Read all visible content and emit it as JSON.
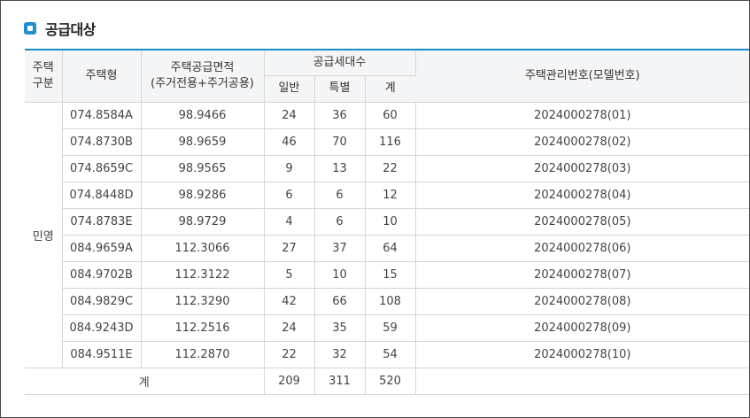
{
  "section_title": "공급대상",
  "headers": {
    "category": [
      "주택",
      "구분"
    ],
    "type": "주택형",
    "area": [
      "주택공급면적",
      "(주거전용+주거공용)"
    ],
    "households": "공급세대수",
    "general": "일반",
    "special": "특별",
    "sum": "계",
    "model_no": "주택관리번호(모델번호)"
  },
  "category_value": "민영",
  "rows": [
    {
      "type": "074.8584A",
      "area": "98.9466",
      "general": "24",
      "special": "36",
      "sum": "60",
      "model": "2024000278(01)"
    },
    {
      "type": "074.8730B",
      "area": "98.9659",
      "general": "46",
      "special": "70",
      "sum": "116",
      "model": "2024000278(02)"
    },
    {
      "type": "074.8659C",
      "area": "98.9565",
      "general": "9",
      "special": "13",
      "sum": "22",
      "model": "2024000278(03)"
    },
    {
      "type": "074.8448D",
      "area": "98.9286",
      "general": "6",
      "special": "6",
      "sum": "12",
      "model": "2024000278(04)"
    },
    {
      "type": "074.8783E",
      "area": "98.9729",
      "general": "4",
      "special": "6",
      "sum": "10",
      "model": "2024000278(05)"
    },
    {
      "type": "084.9659A",
      "area": "112.3066",
      "general": "27",
      "special": "37",
      "sum": "64",
      "model": "2024000278(06)"
    },
    {
      "type": "084.9702B",
      "area": "112.3122",
      "general": "5",
      "special": "10",
      "sum": "15",
      "model": "2024000278(07)"
    },
    {
      "type": "084.9829C",
      "area": "112.3290",
      "general": "42",
      "special": "66",
      "sum": "108",
      "model": "2024000278(08)"
    },
    {
      "type": "084.9243D",
      "area": "112.2516",
      "general": "24",
      "special": "35",
      "sum": "59",
      "model": "2024000278(09)"
    },
    {
      "type": "084.9511E",
      "area": "112.2870",
      "general": "22",
      "special": "32",
      "sum": "54",
      "model": "2024000278(10)"
    }
  ],
  "total": {
    "label": "계",
    "general": "209",
    "special": "311",
    "sum": "520",
    "model": ""
  }
}
